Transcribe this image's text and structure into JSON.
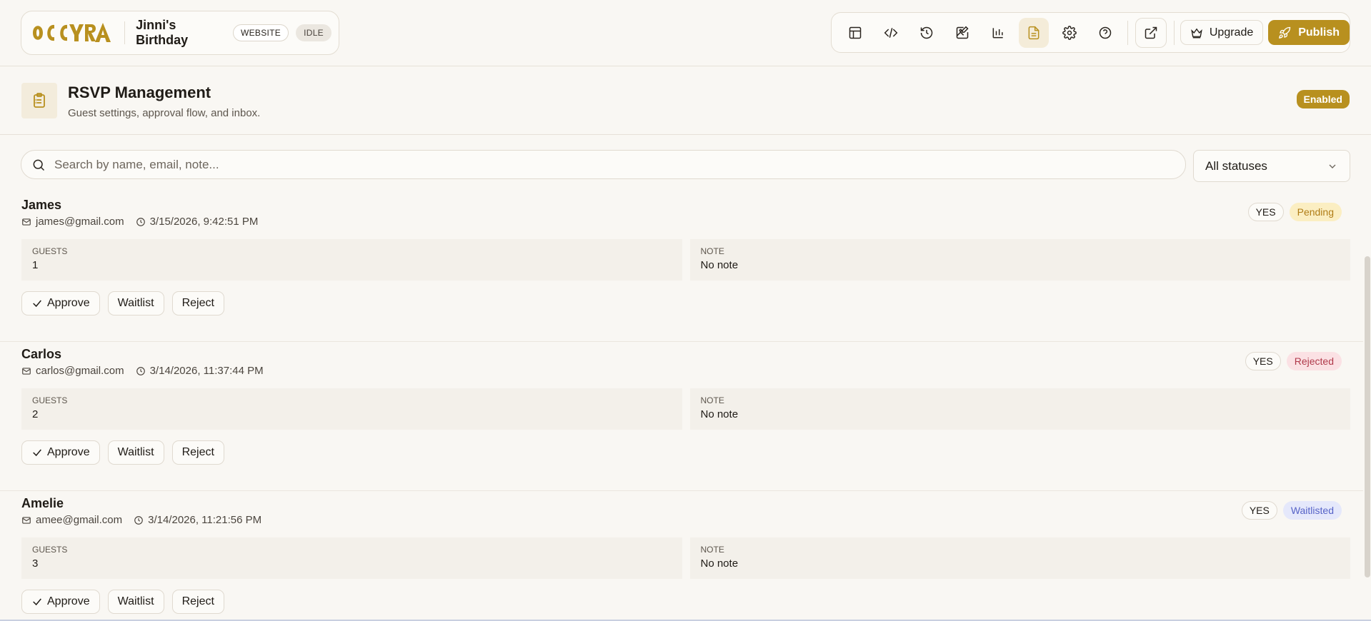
{
  "app": {
    "logo_text": "OCCYRA",
    "project_name": "Jinni's Birthday",
    "type_pill": "WEBSITE",
    "state_pill": "IDLE"
  },
  "toolbar": {
    "icons": [
      "layout-icon",
      "code-icon",
      "history-icon",
      "image-edit-icon",
      "analytics-icon",
      "rsvp-document-icon",
      "settings-gear-icon",
      "help-icon"
    ],
    "active": "rsvp-document-icon",
    "upgrade_label": "Upgrade",
    "publish_label": "Publish"
  },
  "section": {
    "title": "RSVP Management",
    "subtitle": "Guest settings, approval flow, and inbox.",
    "status_badge": "Enabled"
  },
  "search": {
    "placeholder": "Search by name, email, note...",
    "value": ""
  },
  "filter": {
    "selected": "All statuses"
  },
  "rsvps": [
    {
      "name": "James",
      "email": "james@gmail.com",
      "timestamp": "3/15/2026, 9:42:51 PM",
      "response": "YES",
      "status": "Pending",
      "guests_label": "GUESTS",
      "guests": "1",
      "note_label": "NOTE",
      "note": "No note",
      "approve_label": "Approve",
      "waitlist_label": "Waitlist",
      "reject_label": "Reject"
    },
    {
      "name": "Carlos",
      "email": "carlos@gmail.com",
      "timestamp": "3/14/2026, 11:37:44 PM",
      "response": "YES",
      "status": "Rejected",
      "guests_label": "GUESTS",
      "guests": "2",
      "note_label": "NOTE",
      "note": "No note",
      "approve_label": "Approve",
      "waitlist_label": "Waitlist",
      "reject_label": "Reject"
    },
    {
      "name": "Amelie",
      "email": "amee@gmail.com",
      "timestamp": "3/14/2026, 11:21:56 PM",
      "response": "YES",
      "status": "Waitlisted",
      "guests_label": "GUESTS",
      "guests": "3",
      "note_label": "NOTE",
      "note": "No note",
      "approve_label": "Approve",
      "waitlist_label": "Waitlist",
      "reject_label": "Reject"
    }
  ],
  "colors": {
    "accent": "#b8901f",
    "background": "#f9f7f3",
    "pending_bg": "#fbeec2",
    "rejected_bg": "#fbe1e4",
    "waitlisted_bg": "#e5e8fb"
  }
}
